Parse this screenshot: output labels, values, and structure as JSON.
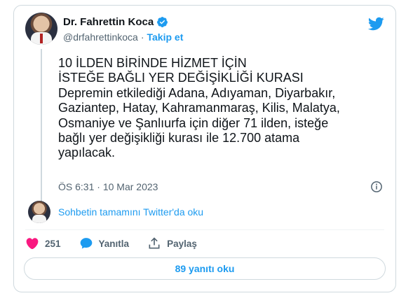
{
  "author": {
    "name": "Dr. Fahrettin Koca",
    "handle": "@drfahrettinkoca",
    "separator": "·",
    "follow_label": "Takip et"
  },
  "tweet": {
    "text": "10 İLDEN BİRİNDE HİZMET İÇİN\nİSTEĞE BAĞLI YER DEĞİŞİKLİĞİ KURASI\nDepremin etkilediği Adana, Adıyaman, Diyarbakır,\nGaziantep, Hatay, Kahramanmaraş, Kilis, Malatya,\nOsmaniye ve Şanlıurfa için diğer 71 ilden, isteğe\nbağlı yer değişikliği kurası ile 12.700 atama\nyapılacak.",
    "time": "ÖS 6:31",
    "date": "10 Mar 2023"
  },
  "conversation": {
    "link_label": "Sohbetin tamamını Twitter'da oku"
  },
  "actions": {
    "likes_count": "251",
    "reply_label": "Yanıtla",
    "share_label": "Paylaş"
  },
  "replies_button": "89 yanıtı oku",
  "colors": {
    "brand_blue": "#1d9bf0",
    "like_red": "#f91880",
    "text_secondary": "#536471",
    "border": "#cfd9de"
  },
  "icons": [
    "verified-badge-icon",
    "twitter-bird-icon",
    "info-icon",
    "heart-icon",
    "reply-bubble-icon",
    "share-icon"
  ]
}
